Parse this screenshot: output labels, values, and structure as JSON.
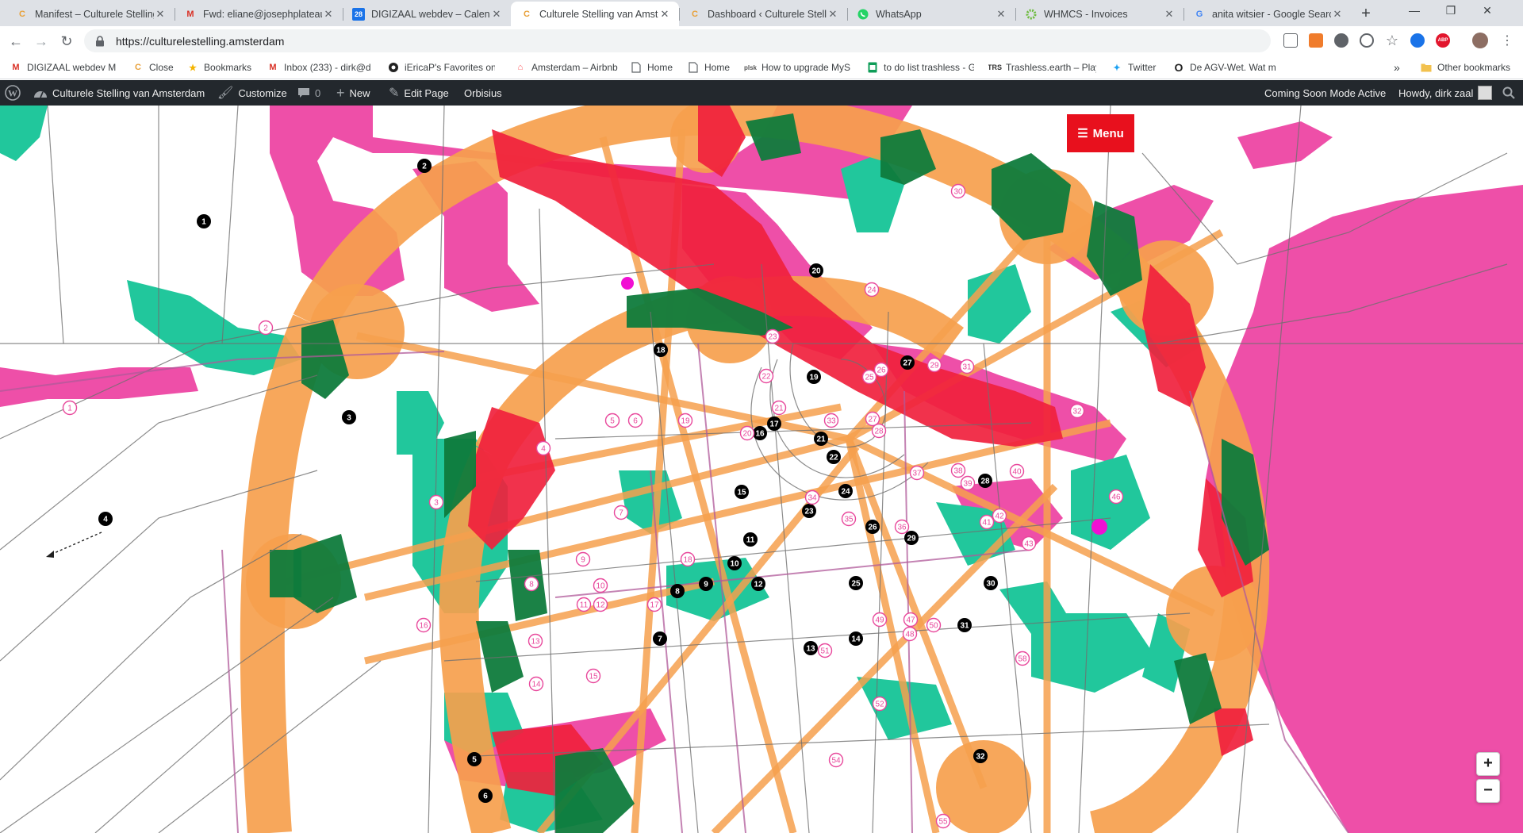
{
  "browser": {
    "tabs": [
      {
        "title": "Manifest – Culturele Stelling",
        "icon": "culturele-stelling-icon",
        "active": false
      },
      {
        "title": "Fwd: eliane@josephplateau",
        "icon": "gmail-icon",
        "active": false
      },
      {
        "title": "DIGIZAAL webdev – Calend",
        "icon": "google-calendar-icon",
        "active": false
      },
      {
        "title": "Culturele Stelling van Amste",
        "icon": "culturele-stelling-icon",
        "active": true
      },
      {
        "title": "Dashboard ‹ Culturele Stelli",
        "icon": "culturele-stelling-icon",
        "active": false
      },
      {
        "title": "WhatsApp",
        "icon": "whatsapp-icon",
        "active": false
      },
      {
        "title": "WHMCS - Invoices",
        "icon": "whmcs-icon",
        "active": false
      },
      {
        "title": "anita witsier - Google Searc",
        "icon": "google-icon",
        "active": false
      }
    ],
    "url": "https://culturelestelling.amsterdam",
    "bookmarks": [
      {
        "label": "DIGIZAAL webdev M",
        "icon": "gmail-icon"
      },
      {
        "label": "Close",
        "icon": "culturele-stelling-icon"
      },
      {
        "label": "Bookmarks",
        "icon": "star-icon"
      },
      {
        "label": "Inbox (233) - dirk@d",
        "icon": "gmail-icon"
      },
      {
        "label": "iEricaP's Favorites on",
        "icon": "circle-icon"
      },
      {
        "label": "Amsterdam – Airbnb",
        "icon": "airbnb-icon"
      },
      {
        "label": "Home",
        "icon": "page-icon"
      },
      {
        "label": "Home",
        "icon": "page-icon"
      },
      {
        "label": "How to upgrade MyS",
        "icon": "plesk-icon"
      },
      {
        "label": "to do list trashless - G",
        "icon": "sheets-icon"
      },
      {
        "label": "Trashless.earth – Play",
        "icon": "trashless-icon"
      },
      {
        "label": "Twitter",
        "icon": "twitter-icon"
      },
      {
        "label": "De AGV-Wet. Wat m",
        "icon": "circle-o-icon"
      }
    ],
    "bookmarks_overflow": "»",
    "other_bookmarks": "Other bookmarks"
  },
  "wp_admin_bar": {
    "site_name": "Culturele Stelling van Amsterdam",
    "customize": "Customize",
    "comments_count": "0",
    "new": "New",
    "edit_page": "Edit Page",
    "orbisius": "Orbisius",
    "coming_soon": "Coming Soon Mode Active",
    "howdy": "Howdy, dirk zaal"
  },
  "page": {
    "menu_label": "Menu",
    "zoom_in": "+",
    "zoom_out": "−"
  },
  "colors": {
    "pink": "#ee4fa8",
    "orange": "#f6a04d",
    "red": "#f0213d",
    "green": "#21c79c",
    "dark_green": "#0f7b3c",
    "purple_line": "#b05a9a"
  },
  "markers": {
    "black": [
      {
        "label": "1"
      },
      {
        "label": "2"
      },
      {
        "label": "3"
      },
      {
        "label": "4"
      },
      {
        "label": "5"
      },
      {
        "label": "6"
      },
      {
        "label": "7"
      },
      {
        "label": "8"
      },
      {
        "label": "9"
      },
      {
        "label": "10"
      },
      {
        "label": "11"
      },
      {
        "label": "12"
      },
      {
        "label": "13"
      },
      {
        "label": "14"
      },
      {
        "label": "15"
      },
      {
        "label": "16"
      },
      {
        "label": "17"
      },
      {
        "label": "18"
      },
      {
        "label": "19"
      },
      {
        "label": "20"
      },
      {
        "label": "21"
      },
      {
        "label": "22"
      },
      {
        "label": "23"
      },
      {
        "label": "24"
      },
      {
        "label": "25"
      },
      {
        "label": "26"
      },
      {
        "label": "27"
      },
      {
        "label": "28"
      },
      {
        "label": "29"
      },
      {
        "label": "30"
      },
      {
        "label": "31"
      },
      {
        "label": "32"
      }
    ],
    "pink": [
      {
        "label": "1"
      },
      {
        "label": "2"
      },
      {
        "label": "3"
      },
      {
        "label": "4"
      },
      {
        "label": "5"
      },
      {
        "label": "6"
      },
      {
        "label": "7"
      },
      {
        "label": "8"
      },
      {
        "label": "9"
      },
      {
        "label": "10"
      },
      {
        "label": "11"
      },
      {
        "label": "12"
      },
      {
        "label": "13"
      },
      {
        "label": "14"
      },
      {
        "label": "15"
      },
      {
        "label": "16"
      },
      {
        "label": "17"
      },
      {
        "label": "18"
      },
      {
        "label": "19"
      },
      {
        "label": "20"
      },
      {
        "label": "21"
      },
      {
        "label": "22"
      },
      {
        "label": "23"
      },
      {
        "label": "24"
      },
      {
        "label": "25"
      },
      {
        "label": "26"
      },
      {
        "label": "27"
      },
      {
        "label": "28"
      },
      {
        "label": "29"
      },
      {
        "label": "30"
      },
      {
        "label": "31"
      },
      {
        "label": "32"
      },
      {
        "label": "33"
      },
      {
        "label": "34"
      },
      {
        "label": "35"
      },
      {
        "label": "36"
      },
      {
        "label": "37"
      },
      {
        "label": "38"
      },
      {
        "label": "39"
      },
      {
        "label": "40"
      },
      {
        "label": "41"
      },
      {
        "label": "42"
      },
      {
        "label": "43"
      },
      {
        "label": "46"
      },
      {
        "label": "47"
      },
      {
        "label": "48"
      },
      {
        "label": "49"
      },
      {
        "label": "50"
      },
      {
        "label": "51"
      },
      {
        "label": "52"
      },
      {
        "label": "54"
      },
      {
        "label": "55"
      },
      {
        "label": "58"
      }
    ]
  }
}
